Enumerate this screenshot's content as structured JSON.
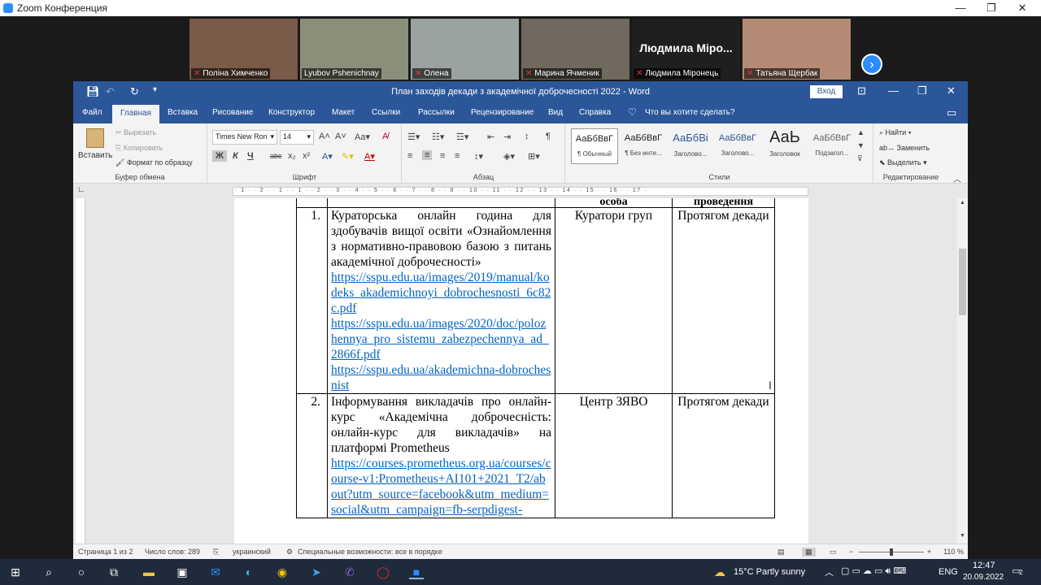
{
  "zoom": {
    "title": "Zoom Конференция",
    "participants": [
      {
        "name": "Поліна Химченко",
        "bg": "#7a5a48",
        "muted": true
      },
      {
        "name": "Lyubov Pshenichnay",
        "bg": "#8a8f7a",
        "muted": false
      },
      {
        "name": "Олена",
        "bg": "#9aa3a0",
        "muted": true
      },
      {
        "name": "Марина Ячменик",
        "bg": "#6f6a5d",
        "muted": true
      },
      {
        "name": "Людмила Міронець",
        "big": "Людмила Міро...",
        "bg": "#1f1f1f",
        "muted": true
      },
      {
        "name": "Татьяна Щербак",
        "bg": "#b58a74",
        "muted": true
      }
    ]
  },
  "word": {
    "title": "План заходів декади з академічної доброчесності 2022  -  Word",
    "signin": "Вход",
    "tabs": [
      "Файл",
      "Главная",
      "Вставка",
      "Рисование",
      "Конструктор",
      "Макет",
      "Ссылки",
      "Рассылки",
      "Рецензирование",
      "Вид",
      "Справка"
    ],
    "tell_me": "Что вы хотите сделать?",
    "clipboard": {
      "paste": "Вставить",
      "cut": "Вырезать",
      "copy": "Копировать",
      "format_painter": "Формат по образцу",
      "label": "Буфер обмена"
    },
    "font": {
      "name": "Times New Ron",
      "size": "14",
      "label": "Шрифт",
      "bold": "Ж",
      "italic": "К",
      "underline": "Ч",
      "strike": "abc"
    },
    "paragraph_label": "Абзац",
    "styles": {
      "label": "Стили",
      "items": [
        {
          "preview": "АаБбВвГ",
          "name": "¶ Обычный"
        },
        {
          "preview": "АаБбВвГ",
          "name": "¶ Без инте..."
        },
        {
          "preview": "АаБбВі",
          "name": "Заголово..."
        },
        {
          "preview": "АаБбВвГ",
          "name": "Заголово..."
        },
        {
          "preview": "АаЬ",
          "name": "Заголовок"
        },
        {
          "preview": "АаБбВвГ",
          "name": "Подзагол..."
        }
      ]
    },
    "editing": {
      "label": "Редактирование",
      "find": "Найти",
      "replace": "Заменить",
      "select": "Выделить"
    },
    "ruler_text": "· 1 · · 2 · · 1 · · 1 · · 2 · · 3 · · 4 · · 5 · · 6 · · 7 · · 8 · · 9 · · 10 · · 11 · · 12 · · 13 · · 14 · · 15 · · 16 · · 17 ·",
    "table": {
      "header": [
        "",
        "",
        "особа",
        "проведення"
      ],
      "rows": [
        {
          "num": "1.",
          "text": "Кураторська онлайн година для здобувачів вищої освіти «Ознайомлення з нормативно-правовою базою з питань академічної доброчесності»",
          "links": [
            "https://sspu.edu.ua/images/2019/manual/kodeks_akademichnoyi_dobrochesnosti_6c82c.pdf",
            "https://sspu.edu.ua/images/2020/doc/polozhennya_pro_sistemu_zabezpechennya_ad_2866f.pdf",
            "https://sspu.edu.ua/akademichna-dobrochesnist"
          ],
          "responsible": "Куратори груп",
          "term": "Протягом декади"
        },
        {
          "num": "2.",
          "text": "Інформування викладачів про онлайн-курс «Академічна доброчесність: онлайн-курс для викладачів» на платформі Prometheus",
          "links": [
            "https://courses.prometheus.org.ua/courses/course-v1:Prometheus+AI101+2021_T2/about?utm_source=facebook&utm_medium=social&utm_campaign=fb-serpdigest-"
          ],
          "responsible": "Центр ЗЯВО",
          "term": "Протягом декади"
        }
      ]
    },
    "status": {
      "page": "Страница 1 из 2",
      "words": "Число слов: 289",
      "language": "украинский",
      "accessibility": "Специальные возможности: все в порядке",
      "zoom": "110 %"
    }
  },
  "taskbar": {
    "weather": "15°C  Partly sunny",
    "lang": "ENG",
    "time": "12:47",
    "date": "20.09.2022",
    "notifications": "2"
  },
  "colors": {
    "word_blue": "#2b579a",
    "zoom_blue": "#2d8cff",
    "link": "#0563c1"
  }
}
